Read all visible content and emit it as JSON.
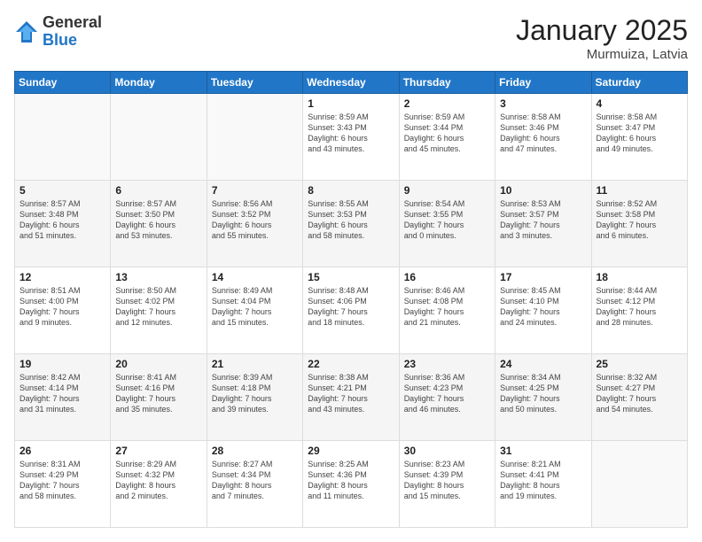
{
  "logo": {
    "general": "General",
    "blue": "Blue"
  },
  "header": {
    "month": "January 2025",
    "location": "Murmuiza, Latvia"
  },
  "weekdays": [
    "Sunday",
    "Monday",
    "Tuesday",
    "Wednesday",
    "Thursday",
    "Friday",
    "Saturday"
  ],
  "weeks": [
    [
      {
        "day": "",
        "info": ""
      },
      {
        "day": "",
        "info": ""
      },
      {
        "day": "",
        "info": ""
      },
      {
        "day": "1",
        "info": "Sunrise: 8:59 AM\nSunset: 3:43 PM\nDaylight: 6 hours\nand 43 minutes."
      },
      {
        "day": "2",
        "info": "Sunrise: 8:59 AM\nSunset: 3:44 PM\nDaylight: 6 hours\nand 45 minutes."
      },
      {
        "day": "3",
        "info": "Sunrise: 8:58 AM\nSunset: 3:46 PM\nDaylight: 6 hours\nand 47 minutes."
      },
      {
        "day": "4",
        "info": "Sunrise: 8:58 AM\nSunset: 3:47 PM\nDaylight: 6 hours\nand 49 minutes."
      }
    ],
    [
      {
        "day": "5",
        "info": "Sunrise: 8:57 AM\nSunset: 3:48 PM\nDaylight: 6 hours\nand 51 minutes."
      },
      {
        "day": "6",
        "info": "Sunrise: 8:57 AM\nSunset: 3:50 PM\nDaylight: 6 hours\nand 53 minutes."
      },
      {
        "day": "7",
        "info": "Sunrise: 8:56 AM\nSunset: 3:52 PM\nDaylight: 6 hours\nand 55 minutes."
      },
      {
        "day": "8",
        "info": "Sunrise: 8:55 AM\nSunset: 3:53 PM\nDaylight: 6 hours\nand 58 minutes."
      },
      {
        "day": "9",
        "info": "Sunrise: 8:54 AM\nSunset: 3:55 PM\nDaylight: 7 hours\nand 0 minutes."
      },
      {
        "day": "10",
        "info": "Sunrise: 8:53 AM\nSunset: 3:57 PM\nDaylight: 7 hours\nand 3 minutes."
      },
      {
        "day": "11",
        "info": "Sunrise: 8:52 AM\nSunset: 3:58 PM\nDaylight: 7 hours\nand 6 minutes."
      }
    ],
    [
      {
        "day": "12",
        "info": "Sunrise: 8:51 AM\nSunset: 4:00 PM\nDaylight: 7 hours\nand 9 minutes."
      },
      {
        "day": "13",
        "info": "Sunrise: 8:50 AM\nSunset: 4:02 PM\nDaylight: 7 hours\nand 12 minutes."
      },
      {
        "day": "14",
        "info": "Sunrise: 8:49 AM\nSunset: 4:04 PM\nDaylight: 7 hours\nand 15 minutes."
      },
      {
        "day": "15",
        "info": "Sunrise: 8:48 AM\nSunset: 4:06 PM\nDaylight: 7 hours\nand 18 minutes."
      },
      {
        "day": "16",
        "info": "Sunrise: 8:46 AM\nSunset: 4:08 PM\nDaylight: 7 hours\nand 21 minutes."
      },
      {
        "day": "17",
        "info": "Sunrise: 8:45 AM\nSunset: 4:10 PM\nDaylight: 7 hours\nand 24 minutes."
      },
      {
        "day": "18",
        "info": "Sunrise: 8:44 AM\nSunset: 4:12 PM\nDaylight: 7 hours\nand 28 minutes."
      }
    ],
    [
      {
        "day": "19",
        "info": "Sunrise: 8:42 AM\nSunset: 4:14 PM\nDaylight: 7 hours\nand 31 minutes."
      },
      {
        "day": "20",
        "info": "Sunrise: 8:41 AM\nSunset: 4:16 PM\nDaylight: 7 hours\nand 35 minutes."
      },
      {
        "day": "21",
        "info": "Sunrise: 8:39 AM\nSunset: 4:18 PM\nDaylight: 7 hours\nand 39 minutes."
      },
      {
        "day": "22",
        "info": "Sunrise: 8:38 AM\nSunset: 4:21 PM\nDaylight: 7 hours\nand 43 minutes."
      },
      {
        "day": "23",
        "info": "Sunrise: 8:36 AM\nSunset: 4:23 PM\nDaylight: 7 hours\nand 46 minutes."
      },
      {
        "day": "24",
        "info": "Sunrise: 8:34 AM\nSunset: 4:25 PM\nDaylight: 7 hours\nand 50 minutes."
      },
      {
        "day": "25",
        "info": "Sunrise: 8:32 AM\nSunset: 4:27 PM\nDaylight: 7 hours\nand 54 minutes."
      }
    ],
    [
      {
        "day": "26",
        "info": "Sunrise: 8:31 AM\nSunset: 4:29 PM\nDaylight: 7 hours\nand 58 minutes."
      },
      {
        "day": "27",
        "info": "Sunrise: 8:29 AM\nSunset: 4:32 PM\nDaylight: 8 hours\nand 2 minutes."
      },
      {
        "day": "28",
        "info": "Sunrise: 8:27 AM\nSunset: 4:34 PM\nDaylight: 8 hours\nand 7 minutes."
      },
      {
        "day": "29",
        "info": "Sunrise: 8:25 AM\nSunset: 4:36 PM\nDaylight: 8 hours\nand 11 minutes."
      },
      {
        "day": "30",
        "info": "Sunrise: 8:23 AM\nSunset: 4:39 PM\nDaylight: 8 hours\nand 15 minutes."
      },
      {
        "day": "31",
        "info": "Sunrise: 8:21 AM\nSunset: 4:41 PM\nDaylight: 8 hours\nand 19 minutes."
      },
      {
        "day": "",
        "info": ""
      }
    ]
  ]
}
